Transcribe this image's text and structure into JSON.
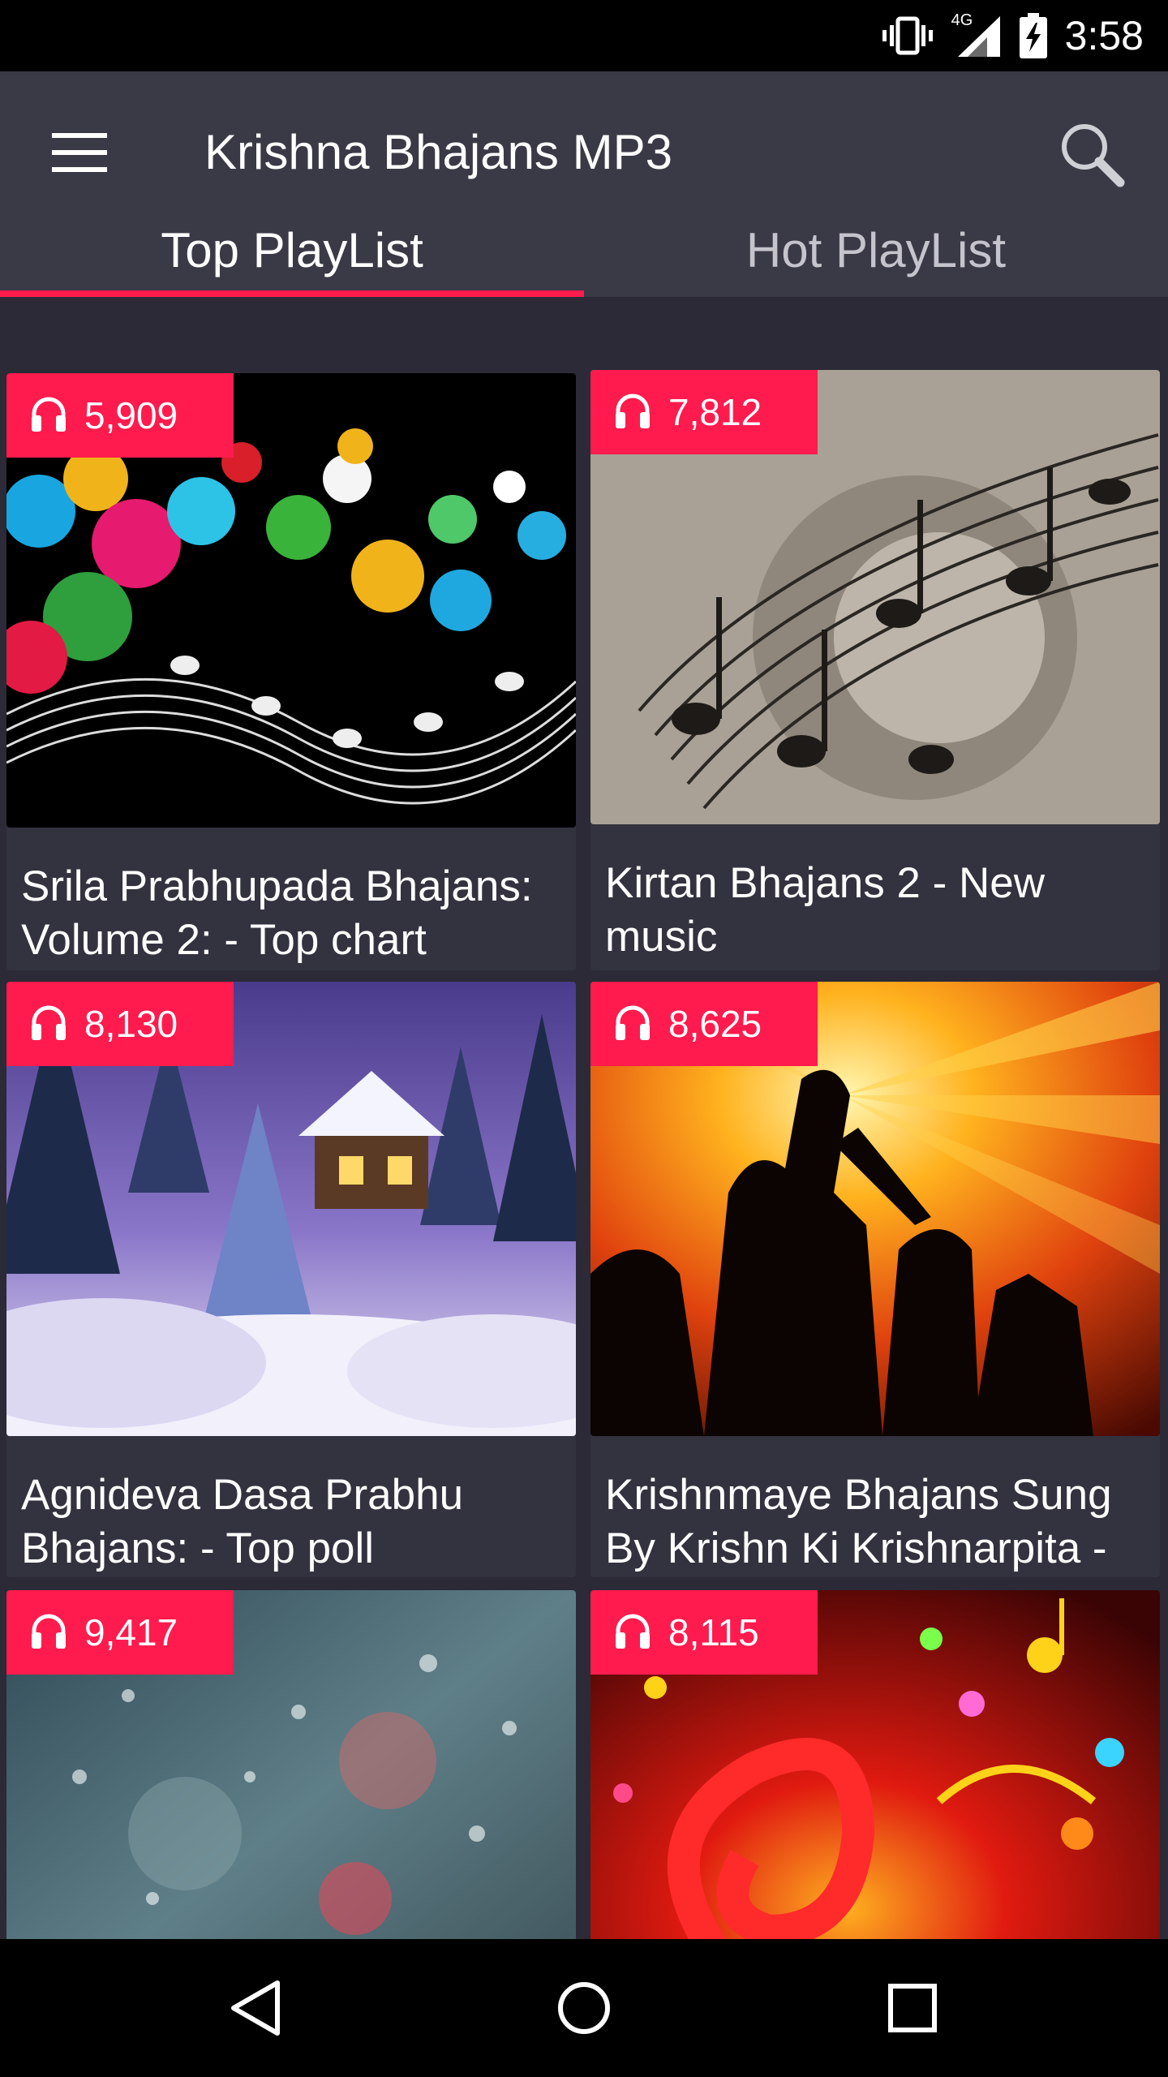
{
  "status_bar": {
    "time": "3:58",
    "network": "4G",
    "icons": [
      "vibrate-icon",
      "signal-icon",
      "battery-charging-icon"
    ]
  },
  "app_bar": {
    "title": "Krishna Bhajans MP3",
    "menu_icon": "menu-icon",
    "search_icon": "search-icon"
  },
  "tabs": [
    {
      "label": "Top PlayList",
      "active": true
    },
    {
      "label": "Hot PlayList",
      "active": false
    }
  ],
  "accent_color": "#ff1b4d",
  "playlists": [
    {
      "plays": "5,909",
      "title": "Srila Prabhupada Bhajans: Volume 2: - Top chart",
      "thumbnail": "colorful-balls-music-notes"
    },
    {
      "plays": "7,812",
      "title": "Kirtan Bhajans 2 - New music",
      "thumbnail": "sepia-music-notes"
    },
    {
      "plays": "8,130",
      "title": "Agnideva Dasa Prabhu Bhajans: - Top poll",
      "thumbnail": "snowy-cabin-night"
    },
    {
      "plays": "8,625",
      "title": "Krishnmaye Bhajans Sung By Krishn Ki Krishnarpita -",
      "thumbnail": "band-silhouette-sunburst"
    },
    {
      "plays": "9,417",
      "title": "",
      "thumbnail": "raindrops-on-glass"
    },
    {
      "plays": "8,115",
      "title": "",
      "thumbnail": "red-treble-clef-notes"
    }
  ],
  "nav_bar": {
    "buttons": [
      "back-icon",
      "home-icon",
      "recents-icon"
    ]
  }
}
